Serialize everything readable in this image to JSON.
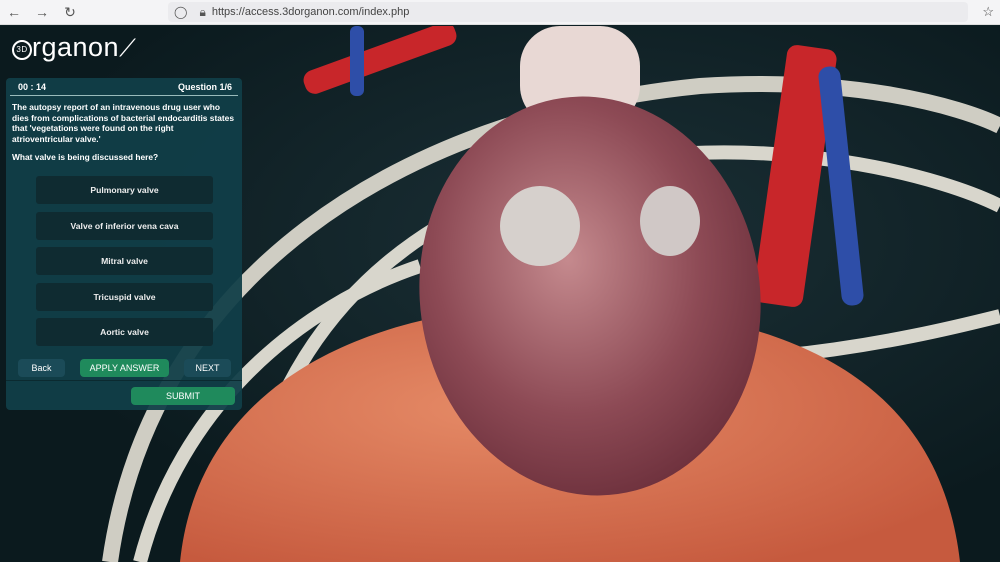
{
  "browser": {
    "url": "https://access.3dorganon.com/index.php"
  },
  "logo": {
    "badge": "3D",
    "text": "rganon"
  },
  "quiz": {
    "timer": "00 : 14",
    "question_counter": "Question 1/6",
    "question": "The autopsy report of an intravenous drug user who dies from complications of bacterial endocarditis states that 'vegetations were found on the right atrioventricular valve.'",
    "prompt": "What valve is being discussed here?",
    "options": [
      "Pulmonary valve",
      "Valve of inferior vena cava",
      "Mitral valve",
      "Tricuspid valve",
      "Aortic valve"
    ],
    "back_label": "Back",
    "apply_label": "APPLY ANSWER",
    "next_label": "NEXT",
    "submit_label": "SUBMIT"
  },
  "colors": {
    "panel": "#113e48",
    "option": "#0f2b31",
    "green": "#1f8a5c",
    "dark_btn": "#1b4b58"
  }
}
